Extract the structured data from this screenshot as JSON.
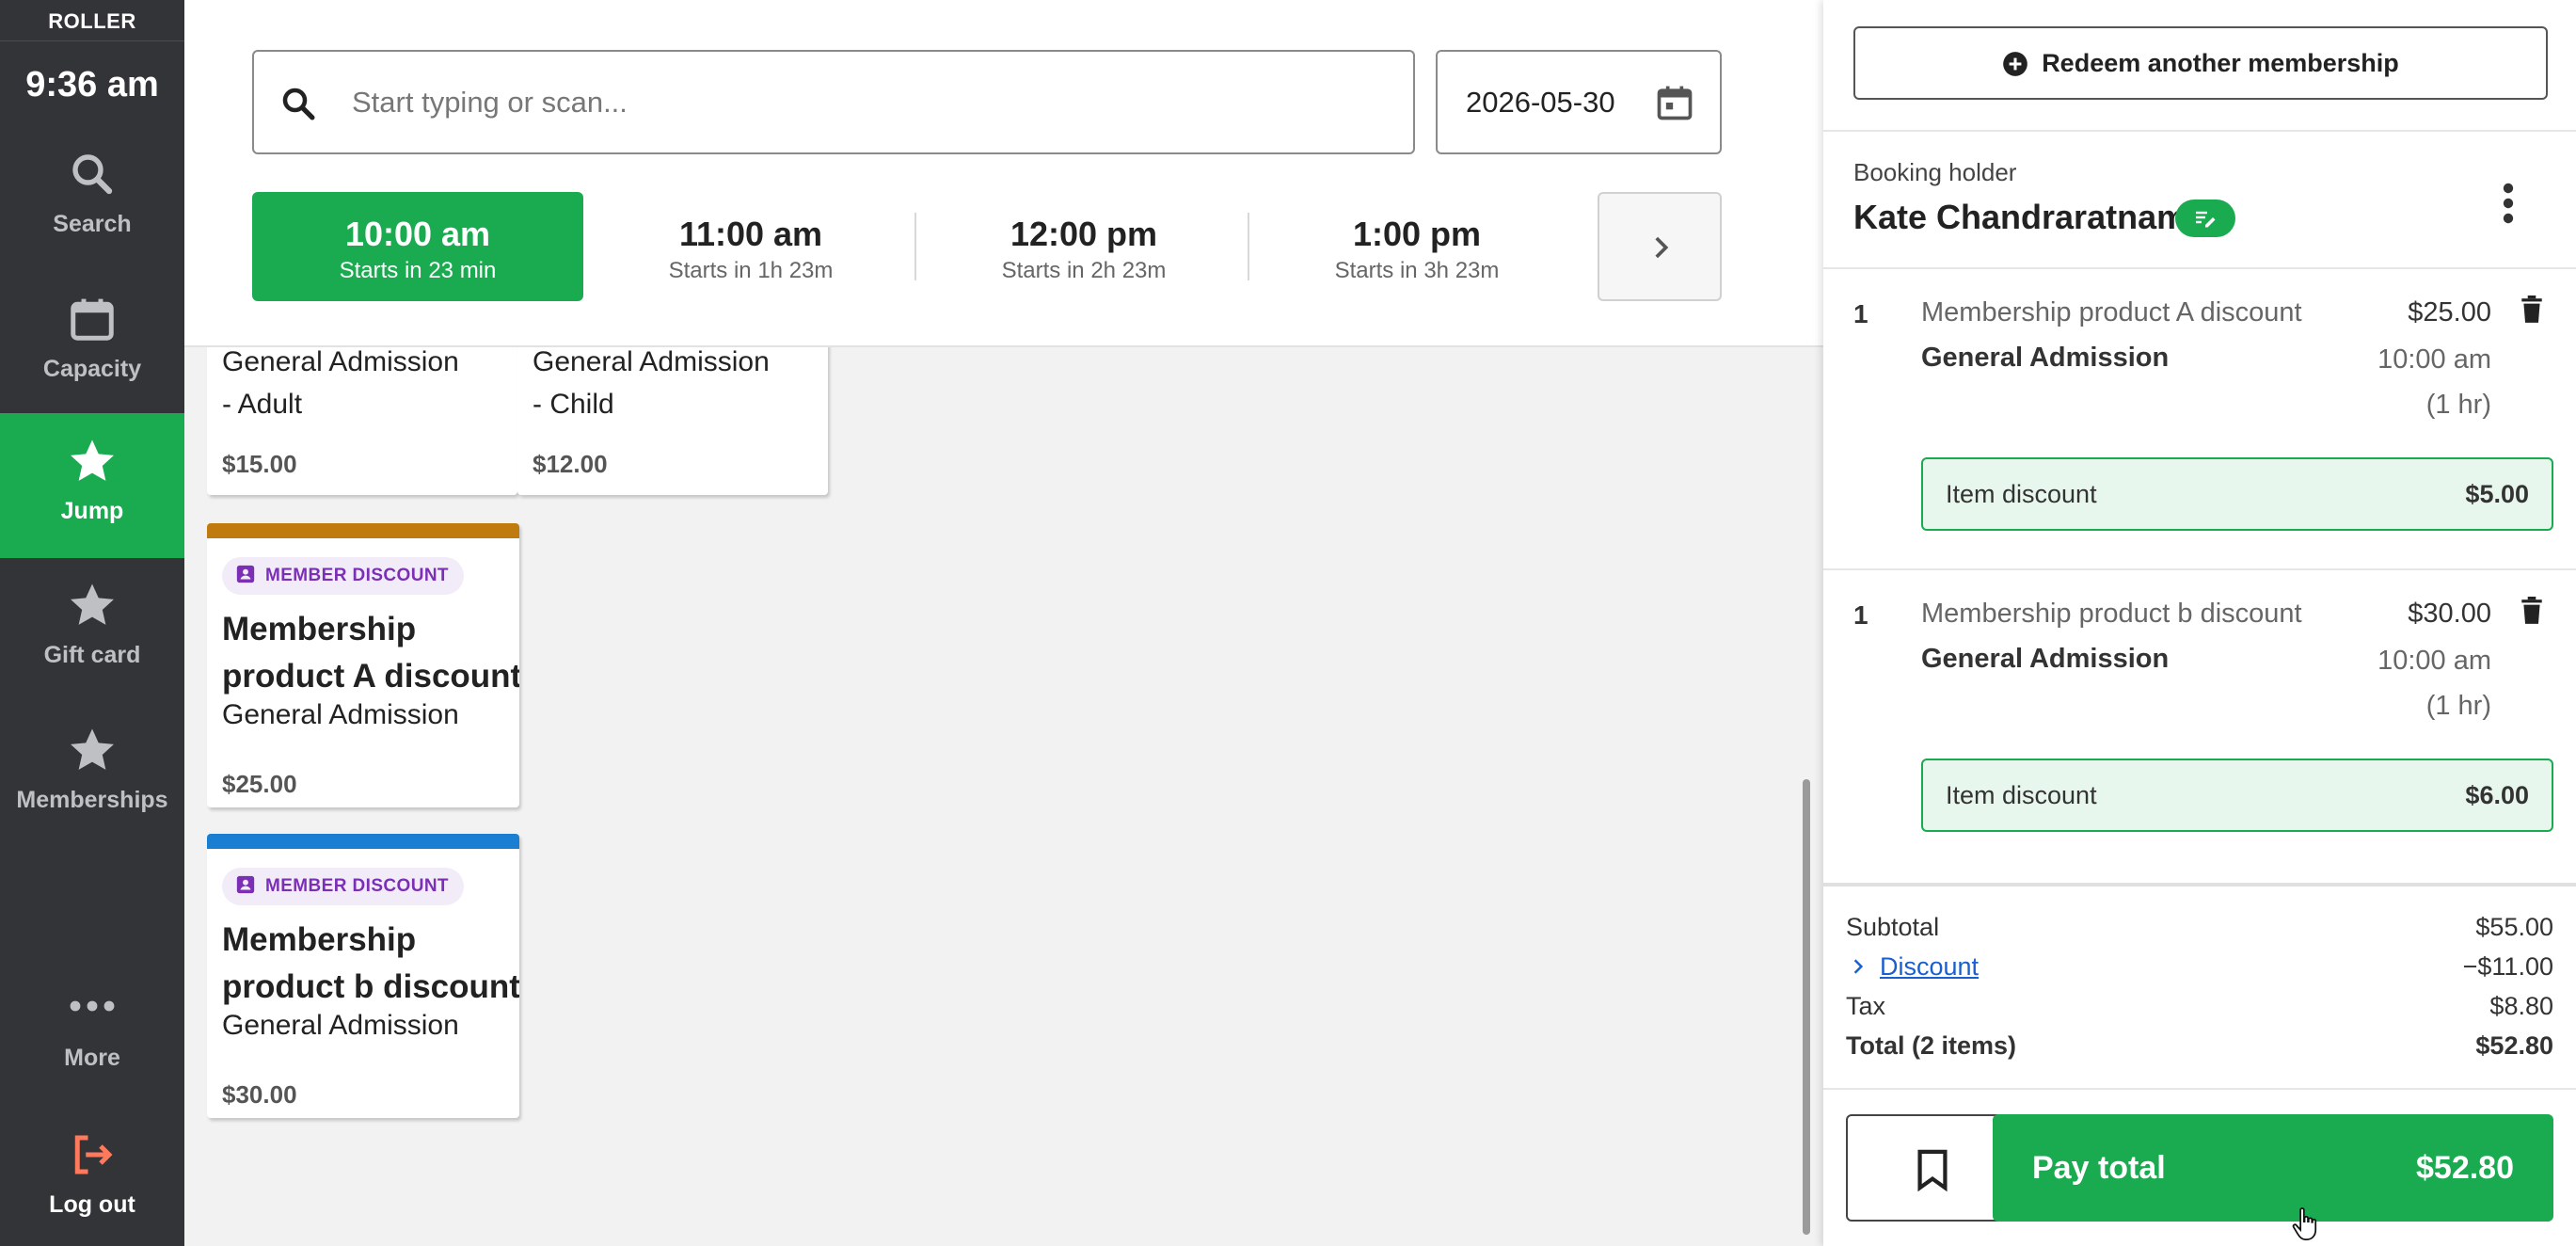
{
  "sidebar": {
    "brand": "ROLLER",
    "clock": "9:36 am",
    "items": [
      {
        "label": "Search",
        "icon": "search-icon"
      },
      {
        "label": "Capacity",
        "icon": "calendar-icon"
      },
      {
        "label": "Jump",
        "icon": "star-icon",
        "active": true
      },
      {
        "label": "Gift card",
        "icon": "star-icon"
      },
      {
        "label": "Memberships",
        "icon": "star-icon"
      },
      {
        "label": "More",
        "icon": "more-dots-icon"
      },
      {
        "label": "Log out",
        "icon": "logout-icon"
      }
    ]
  },
  "topbar": {
    "search_placeholder": "Start typing or scan...",
    "date": "2026-05-30",
    "slots": [
      {
        "time": "10:00 am",
        "sub": "Starts in 23 min",
        "active": true
      },
      {
        "time": "11:00 am",
        "sub": "Starts in 1h 23m"
      },
      {
        "time": "12:00 pm",
        "sub": "Starts in 2h 23m"
      },
      {
        "time": "1:00 pm",
        "sub": "Starts in 3h 23m"
      }
    ]
  },
  "products": {
    "partial": [
      {
        "line1": "General Admission",
        "line2": "- Adult",
        "price": "$15.00"
      },
      {
        "line1": "General Admission",
        "line2": "- Child",
        "price": "$12.00"
      }
    ],
    "cards": [
      {
        "badge": "MEMBER DISCOUNT",
        "title": "Membership product A discount",
        "subtitle": "General Admission",
        "price": "$25.00",
        "color": "#c07b10"
      },
      {
        "badge": "MEMBER DISCOUNT",
        "title": "Membership product b discount",
        "subtitle": "General Admission",
        "price": "$30.00",
        "color": "#1a7fd0"
      }
    ]
  },
  "panel": {
    "redeem_label": "Redeem another membership",
    "holder_label": "Booking holder",
    "holder_name": "Kate Chandraratnam",
    "lines": [
      {
        "qty": "1",
        "name": "Membership product A discount",
        "type": "General Admission",
        "price": "$25.00",
        "time": "10:00 am",
        "duration": "(1 hr)",
        "discount_label": "Item discount",
        "discount_value": "$5.00"
      },
      {
        "qty": "1",
        "name": "Membership product b discount",
        "type": "General Admission",
        "price": "$30.00",
        "time": "10:00 am",
        "duration": "(1 hr)",
        "discount_label": "Item discount",
        "discount_value": "$6.00"
      }
    ],
    "summary": {
      "subtotal_label": "Subtotal",
      "subtotal": "$55.00",
      "discount_label": "Discount",
      "discount": "−$11.00",
      "tax_label": "Tax",
      "tax": "$8.80",
      "total_label": "Total (2 items)",
      "total": "$52.80"
    },
    "pay_label": "Pay total",
    "pay_value": "$52.80"
  },
  "colors": {
    "accent": "#1aab50",
    "sidebar": "#333438",
    "badge_text": "#7b2fb5"
  }
}
